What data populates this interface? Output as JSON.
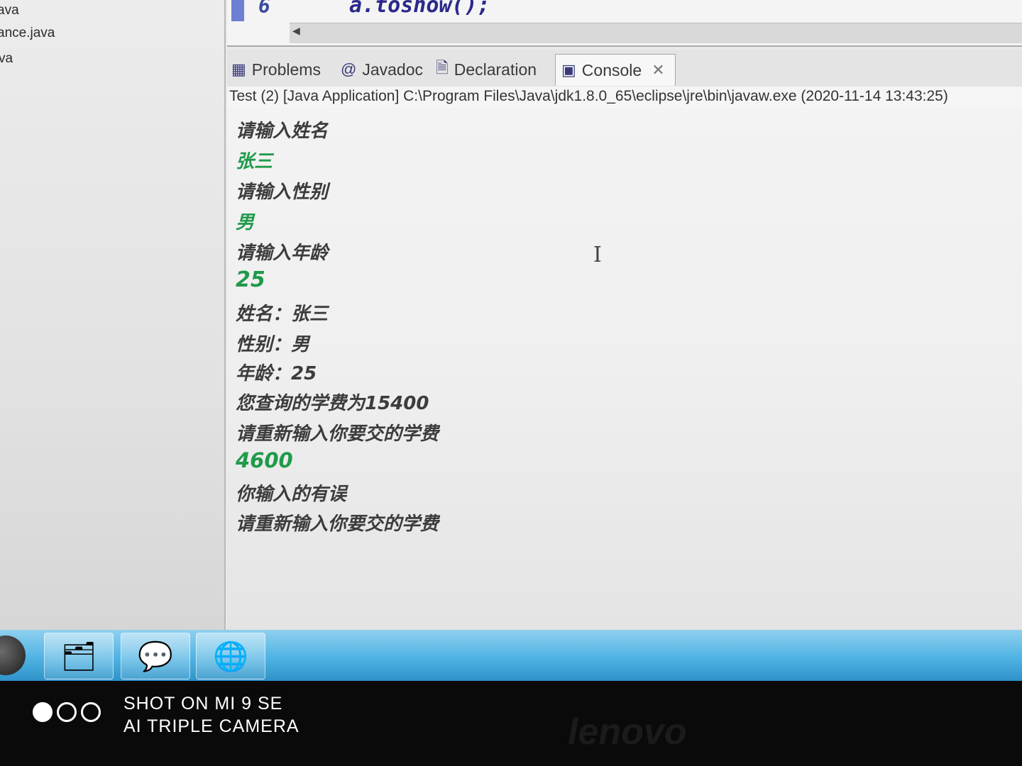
{
  "explorer": {
    "files": [
      "ava",
      "ance.java",
      "va"
    ]
  },
  "editor": {
    "line_number": "6",
    "code": "a.toshow();"
  },
  "tabs": [
    {
      "label": "Problems",
      "icon": "problems-icon"
    },
    {
      "label": "Javadoc",
      "icon": "at-icon"
    },
    {
      "label": "Declaration",
      "icon": "declaration-icon"
    },
    {
      "label": "Console",
      "icon": "console-icon",
      "active": true
    }
  ],
  "console": {
    "header": "Test (2) [Java Application] C:\\Program Files\\Java\\jdk1.8.0_65\\eclipse\\jre\\bin\\javaw.exe  (2020-11-14 13:43:25)",
    "lines": [
      {
        "text": "请输入姓名",
        "kind": "out"
      },
      {
        "text": "张三",
        "kind": "in"
      },
      {
        "text": "请输入性别",
        "kind": "out"
      },
      {
        "text": "男",
        "kind": "in"
      },
      {
        "text": "请输入年龄",
        "kind": "out"
      },
      {
        "text": "25",
        "kind": "in"
      },
      {
        "text": "姓名：张三",
        "kind": "out"
      },
      {
        "text": "性别：男",
        "kind": "out"
      },
      {
        "text": "年龄：25",
        "kind": "out"
      },
      {
        "text": "您查询的学费为15400",
        "kind": "out"
      },
      {
        "text": "请重新输入你要交的学费",
        "kind": "out"
      },
      {
        "text": "4600",
        "kind": "in"
      },
      {
        "text": "你输入的有误",
        "kind": "out"
      },
      {
        "text": "请重新输入你要交的学费",
        "kind": "out"
      }
    ]
  },
  "taskbar": {
    "apps": [
      "file-explorer-icon",
      "wechat-icon",
      "qq-browser-icon"
    ]
  },
  "watermark": {
    "line1": "SHOT ON MI 9 SE",
    "line2": "AI TRIPLE CAMERA",
    "brand": "lenovo"
  },
  "colors": {
    "console_output": "#3c3c3c",
    "console_input": "#1f9a4a",
    "taskbar": "#4fb3e3"
  }
}
